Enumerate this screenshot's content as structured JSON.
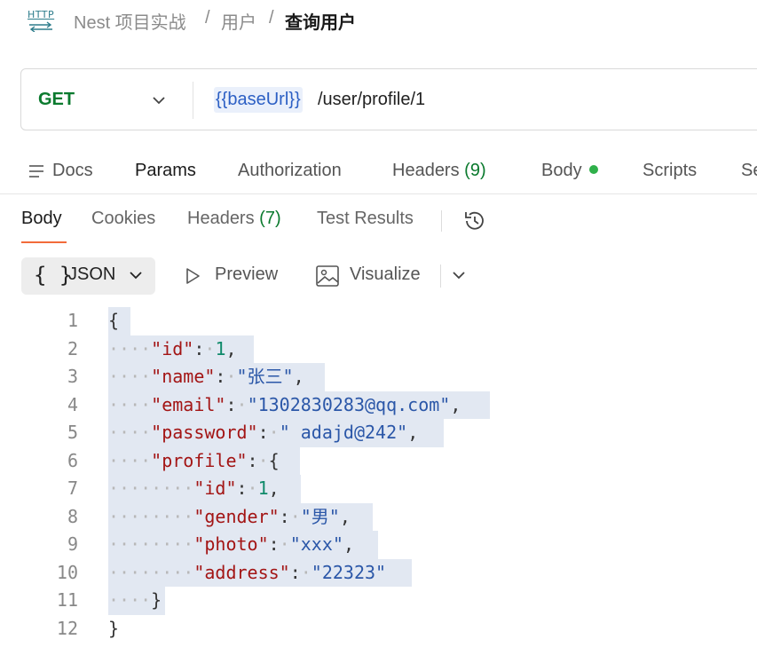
{
  "breadcrumb": {
    "icon_label": "HTTP",
    "items": [
      "Nest 项目实战",
      "用户",
      "查询用户"
    ],
    "separator": "/"
  },
  "request": {
    "method": "GET",
    "url_variable": "{{baseUrl}}",
    "url_path": "/user/profile/1"
  },
  "request_tabs": [
    {
      "label": "Docs"
    },
    {
      "label": "Params"
    },
    {
      "label": "Authorization"
    },
    {
      "label": "Headers",
      "count": "(9)"
    },
    {
      "label": "Body"
    },
    {
      "label": "Scripts"
    },
    {
      "label": "Se"
    }
  ],
  "response_tabs": [
    {
      "label": "Body"
    },
    {
      "label": "Cookies"
    },
    {
      "label": "Headers",
      "count": "(7)"
    },
    {
      "label": "Test Results"
    }
  ],
  "format_toolbar": {
    "format": "JSON",
    "format_icon": "{ }",
    "preview": "Preview",
    "visualize": "Visualize"
  },
  "code": {
    "line_numbers": [
      "1",
      "2",
      "3",
      "4",
      "5",
      "6",
      "7",
      "8",
      "9",
      "10",
      "11",
      "12"
    ],
    "lines": [
      [
        {
          "t": "p",
          "v": "{"
        }
      ],
      [
        {
          "t": "k",
          "v": "\"id\""
        },
        {
          "t": "p",
          "v": ":"
        },
        {
          "t": "n",
          "v": "1"
        },
        {
          "t": "p",
          "v": ","
        }
      ],
      [
        {
          "t": "k",
          "v": "\"name\""
        },
        {
          "t": "p",
          "v": ":"
        },
        {
          "t": "s",
          "v": "\"张三\""
        },
        {
          "t": "p",
          "v": ","
        }
      ],
      [
        {
          "t": "k",
          "v": "\"email\""
        },
        {
          "t": "p",
          "v": ":"
        },
        {
          "t": "s",
          "v": "\"1302830283@qq.com\""
        },
        {
          "t": "p",
          "v": ","
        }
      ],
      [
        {
          "t": "k",
          "v": "\"password\""
        },
        {
          "t": "p",
          "v": ":"
        },
        {
          "t": "s",
          "v": "\" adajd@242\""
        },
        {
          "t": "p",
          "v": ","
        }
      ],
      [
        {
          "t": "k",
          "v": "\"profile\""
        },
        {
          "t": "p",
          "v": ":"
        },
        {
          "t": "p",
          "v": "{"
        }
      ],
      [
        {
          "t": "k",
          "v": "\"id\""
        },
        {
          "t": "p",
          "v": ":"
        },
        {
          "t": "n",
          "v": "1"
        },
        {
          "t": "p",
          "v": ","
        }
      ],
      [
        {
          "t": "k",
          "v": "\"gender\""
        },
        {
          "t": "p",
          "v": ":"
        },
        {
          "t": "s",
          "v": "\"男\""
        },
        {
          "t": "p",
          "v": ","
        }
      ],
      [
        {
          "t": "k",
          "v": "\"photo\""
        },
        {
          "t": "p",
          "v": ":"
        },
        {
          "t": "s",
          "v": "\"xxx\""
        },
        {
          "t": "p",
          "v": ","
        }
      ],
      [
        {
          "t": "k",
          "v": "\"address\""
        },
        {
          "t": "p",
          "v": ":"
        },
        {
          "t": "s",
          "v": "\"22323\""
        }
      ],
      [
        {
          "t": "p",
          "v": "}"
        }
      ],
      [
        {
          "t": "p",
          "v": "}"
        }
      ]
    ]
  },
  "colors": {
    "method_get": "#0b7a2e",
    "active_tab_underline": "#f26b3a",
    "body_dot": "#2fb04a",
    "json_key": "#a31515",
    "json_string": "#2b57a8",
    "json_number": "#0f8a6a"
  }
}
